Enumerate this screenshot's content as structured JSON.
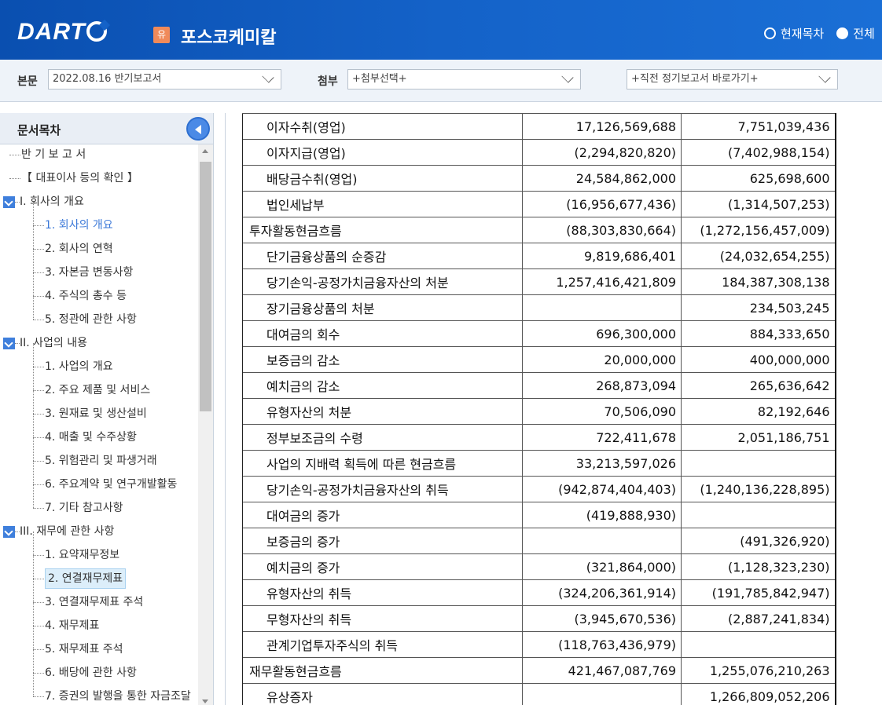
{
  "header": {
    "logo": "DART",
    "company_badge": "유",
    "company_name": "포스코케미칼",
    "radio_current": "현재목차",
    "radio_all": "전체"
  },
  "selectors": {
    "main_label": "본문",
    "main_value": "2022.08.16  반기보고서",
    "attach_label": "첨부",
    "attach_value": "+첨부선택+",
    "shortcut_value": "+직전 정기보고서 바로가기+"
  },
  "sidebar": {
    "title": "문서목차",
    "items": [
      {
        "label": "반 기 보 고 서",
        "level": 0
      },
      {
        "label": "【 대표이사 등의 확인 】",
        "level": 0
      },
      {
        "label": "I. 회사의 개요",
        "level": 1
      },
      {
        "label": "1. 회사의 개요",
        "level": 2,
        "state": "active"
      },
      {
        "label": "2. 회사의 연혁",
        "level": 2
      },
      {
        "label": "3. 자본금 변동사항",
        "level": 2
      },
      {
        "label": "4. 주식의 총수 등",
        "level": 2
      },
      {
        "label": "5. 정관에 관한 사항",
        "level": 2
      },
      {
        "label": "II. 사업의 내용",
        "level": 1
      },
      {
        "label": "1. 사업의 개요",
        "level": 2
      },
      {
        "label": "2. 주요 제품 및 서비스",
        "level": 2
      },
      {
        "label": "3. 원재료 및 생산설비",
        "level": 2
      },
      {
        "label": "4. 매출 및 수주상황",
        "level": 2
      },
      {
        "label": "5. 위험관리 및 파생거래",
        "level": 2
      },
      {
        "label": "6. 주요계약 및 연구개발활동",
        "level": 2
      },
      {
        "label": "7. 기타 참고사항",
        "level": 2
      },
      {
        "label": "III. 재무에 관한 사항",
        "level": 1
      },
      {
        "label": "1. 요약재무정보",
        "level": 2
      },
      {
        "label": "2. 연결재무제표",
        "level": 2,
        "state": "selected"
      },
      {
        "label": "3. 연결재무제표 주석",
        "level": 2
      },
      {
        "label": "4. 재무제표",
        "level": 2
      },
      {
        "label": "5. 재무제표 주석",
        "level": 2
      },
      {
        "label": "6. 배당에 관한 사항",
        "level": 2
      },
      {
        "label": "7. 증권의 발행을 통한 자금조달",
        "level": 2
      }
    ]
  },
  "table": {
    "rows": [
      {
        "label": "이자수취(영업)",
        "c1": "17,126,569,688",
        "c2": "7,751,039,436"
      },
      {
        "label": "이자지급(영업)",
        "c1": "(2,294,820,820)",
        "c2": "(7,402,988,154)"
      },
      {
        "label": "배당금수취(영업)",
        "c1": "24,584,862,000",
        "c2": "625,698,600"
      },
      {
        "label": "법인세납부",
        "c1": "(16,956,677,436)",
        "c2": "(1,314,507,253)"
      },
      {
        "label": "투자활동현금흐름",
        "c1": "(88,303,830,664)",
        "c2": "(1,272,156,457,009)",
        "section": true
      },
      {
        "label": "단기금융상품의 순증감",
        "c1": "9,819,686,401",
        "c2": "(24,032,654,255)"
      },
      {
        "label": "당기손익-공정가치금융자산의 처분",
        "c1": "1,257,416,421,809",
        "c2": "184,387,308,138"
      },
      {
        "label": "장기금융상품의 처분",
        "c1": "",
        "c2": "234,503,245"
      },
      {
        "label": "대여금의 회수",
        "c1": "696,300,000",
        "c2": "884,333,650"
      },
      {
        "label": "보증금의 감소",
        "c1": "20,000,000",
        "c2": "400,000,000"
      },
      {
        "label": "예치금의 감소",
        "c1": "268,873,094",
        "c2": "265,636,642"
      },
      {
        "label": "유형자산의 처분",
        "c1": "70,506,090",
        "c2": "82,192,646"
      },
      {
        "label": "정부보조금의 수령",
        "c1": "722,411,678",
        "c2": "2,051,186,751"
      },
      {
        "label": "사업의 지배력 획득에 따른 현금흐름",
        "c1": "33,213,597,026",
        "c2": ""
      },
      {
        "label": "당기손익-공정가치금융자산의 취득",
        "c1": "(942,874,404,403)",
        "c2": "(1,240,136,228,895)"
      },
      {
        "label": "대여금의 증가",
        "c1": "(419,888,930)",
        "c2": ""
      },
      {
        "label": "보증금의 증가",
        "c1": "",
        "c2": "(491,326,920)"
      },
      {
        "label": "예치금의 증가",
        "c1": "(321,864,000)",
        "c2": "(1,128,323,230)"
      },
      {
        "label": "유형자산의 취득",
        "c1": "(324,206,361,914)",
        "c2": "(191,785,842,947)"
      },
      {
        "label": "무형자산의 취득",
        "c1": "(3,945,670,536)",
        "c2": "(2,887,241,834)"
      },
      {
        "label": "관계기업투자주식의 취득",
        "c1": "(118,763,436,979)",
        "c2": ""
      },
      {
        "label": "재무활동현금흐름",
        "c1": "421,467,087,769",
        "c2": "1,255,076,210,263",
        "section": true
      },
      {
        "label": "유상증자",
        "c1": "",
        "c2": "1,266,809,052,206"
      }
    ]
  }
}
